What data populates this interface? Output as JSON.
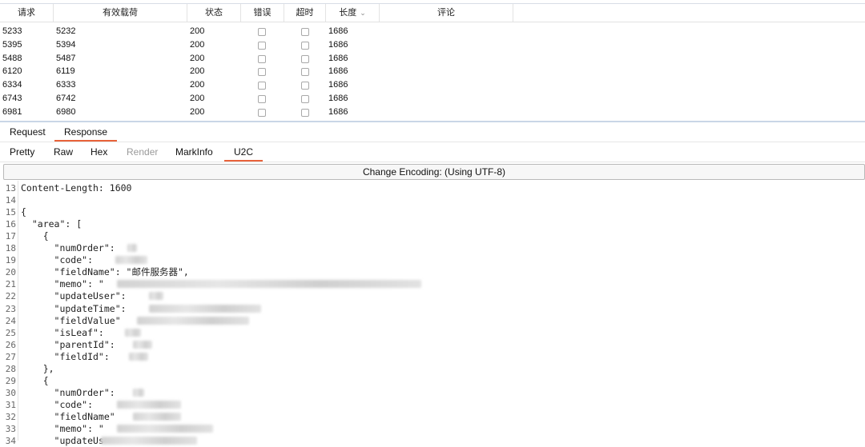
{
  "table": {
    "columns": [
      "请求",
      "有效载荷",
      "状态",
      "错误",
      "超时",
      "长度",
      "评论"
    ],
    "rows": [
      {
        "request": "5233",
        "payload": "5232",
        "status": "200",
        "length": "1686"
      },
      {
        "request": "5395",
        "payload": "5394",
        "status": "200",
        "length": "1686"
      },
      {
        "request": "5488",
        "payload": "5487",
        "status": "200",
        "length": "1686"
      },
      {
        "request": "6120",
        "payload": "6119",
        "status": "200",
        "length": "1686"
      },
      {
        "request": "6334",
        "payload": "6333",
        "status": "200",
        "length": "1686"
      },
      {
        "request": "6743",
        "payload": "6742",
        "status": "200",
        "length": "1686"
      },
      {
        "request": "6981",
        "payload": "6980",
        "status": "200",
        "length": "1686"
      }
    ]
  },
  "message_tabs": [
    "Request",
    "Response"
  ],
  "view_tabs": [
    "Pretty",
    "Raw",
    "Hex",
    "Render",
    "MarkInfo",
    "U2C"
  ],
  "encoding_label": "Change Encoding: (Using UTF-8)",
  "editor": {
    "lines": [
      {
        "n": "13",
        "text": "Content-Length: 1600"
      },
      {
        "n": "14",
        "text": ""
      },
      {
        "n": "15",
        "text": "{"
      },
      {
        "n": "16",
        "text": "  \"area\": ["
      },
      {
        "n": "17",
        "text": "    {"
      },
      {
        "n": "18",
        "text": "      \"numOrder\":"
      },
      {
        "n": "19",
        "text": "      \"code\":"
      },
      {
        "n": "20",
        "text": "      \"fieldName\": \"邮件服务器\","
      },
      {
        "n": "21",
        "text": "      \"memo\": \""
      },
      {
        "n": "22",
        "text": "      \"updateUser\":"
      },
      {
        "n": "23",
        "text": "      \"updateTime\":"
      },
      {
        "n": "24",
        "text": "      \"fieldValue\""
      },
      {
        "n": "25",
        "text": "      \"isLeaf\":"
      },
      {
        "n": "26",
        "text": "      \"parentId\":"
      },
      {
        "n": "27",
        "text": "      \"fieldId\":"
      },
      {
        "n": "28",
        "text": "    },"
      },
      {
        "n": "29",
        "text": "    {"
      },
      {
        "n": "30",
        "text": "      \"numOrder\":"
      },
      {
        "n": "31",
        "text": "      \"code\":"
      },
      {
        "n": "32",
        "text": "      \"fieldName\""
      },
      {
        "n": "33",
        "text": "      \"memo\": \""
      },
      {
        "n": "34",
        "text": "      \"updateUs"
      }
    ]
  },
  "colors": {
    "accent": "#e8623a",
    "border": "#e3e3e3"
  }
}
